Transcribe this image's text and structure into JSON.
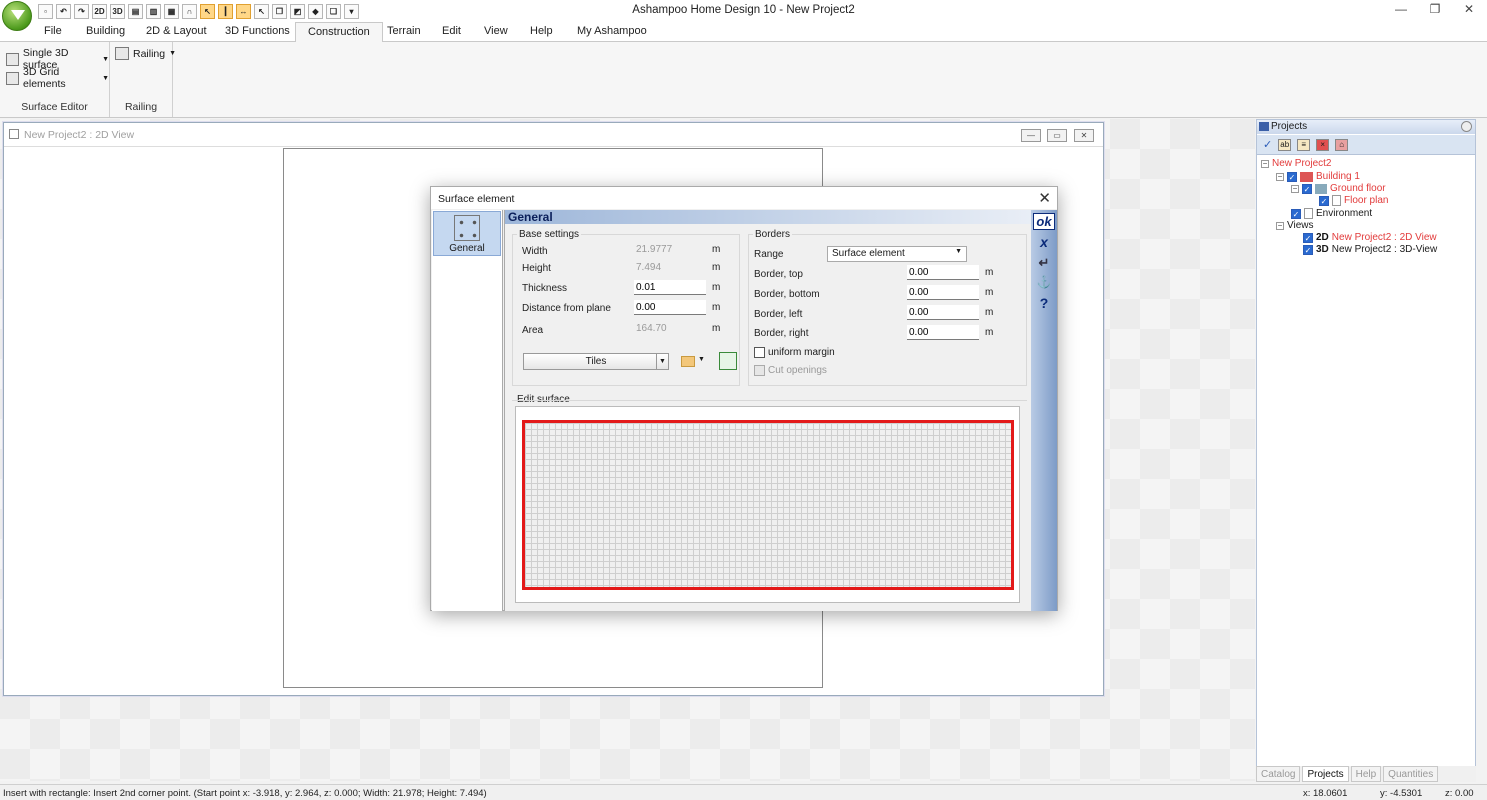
{
  "window": {
    "title": "Ashampoo Home Design 10 - New Project2"
  },
  "ribbon_tabs": [
    {
      "label": "File"
    },
    {
      "label": "Building"
    },
    {
      "label": "2D & Layout"
    },
    {
      "label": "3D Functions"
    },
    {
      "label": "Construction"
    },
    {
      "label": "Terrain"
    },
    {
      "label": "Edit"
    },
    {
      "label": "View"
    },
    {
      "label": "Help"
    },
    {
      "label": "My Ashampoo"
    }
  ],
  "quick_access": {
    "btn_2d": "2D",
    "btn_3d": "3D"
  },
  "ribbon": {
    "single_surface": "Single 3D surface",
    "grid_elements": "3D Grid elements",
    "group_surface_editor": "Surface Editor",
    "railing": "Railing",
    "group_railing": "Railing"
  },
  "doc_window": {
    "title": "New Project2 : 2D View"
  },
  "dialog": {
    "title": "Surface element",
    "side_item": "General",
    "header": "General",
    "base_settings": {
      "label": "Base settings",
      "width_label": "Width",
      "width_value": "21.9777",
      "height_label": "Height",
      "height_value": "7.494",
      "thickness_label": "Thickness",
      "thickness_value": "0.01",
      "distance_label": "Distance from plane",
      "distance_value": "0.00",
      "area_label": "Area",
      "area_value": "164.70",
      "unit": "m",
      "tiles_button": "Tiles"
    },
    "borders": {
      "label": "Borders",
      "range_label": "Range",
      "range_value": "Surface element",
      "top_label": "Border, top",
      "top_value": "0.00",
      "bottom_label": "Border, bottom",
      "bottom_value": "0.00",
      "left_label": "Border, left",
      "left_value": "0.00",
      "right_label": "Border, right",
      "right_value": "0.00",
      "unit": "m",
      "uniform_margin": "uniform margin",
      "cut_openings": "Cut openings"
    },
    "edit_surface_label": "Edit surface",
    "actions": {
      "ok": "ok",
      "cancel": "x",
      "apply": "↵",
      "help": "?"
    }
  },
  "projects": {
    "title": "Projects",
    "tree": {
      "project": "New Project2",
      "building": "Building 1",
      "floor": "Ground floor",
      "floor_plan": "Floor plan",
      "environment": "Environment",
      "views": "Views",
      "view_2d_prefix": "2D",
      "view_2d": "New Project2 : 2D View",
      "view_3d_prefix": "3D",
      "view_3d": "New Project2 : 3D-View"
    },
    "bottom_tabs": [
      {
        "label": "Catalog"
      },
      {
        "label": "Projects"
      },
      {
        "label": "Help"
      },
      {
        "label": "Quantities"
      }
    ]
  },
  "statusbar": {
    "message": "Insert with rectangle: Insert 2nd corner point. (Start point  x: -3.918,  y:  2.964,  z:  0.000;  Width:  21.978;  Height:  7.494)",
    "x": "x: 18.0601",
    "y": "y: -4.5301",
    "z": "z: 0.00"
  },
  "colors": {
    "accent": "#e31919",
    "selection": "#c5d8f0",
    "header_blue": "#0b1f5a"
  }
}
